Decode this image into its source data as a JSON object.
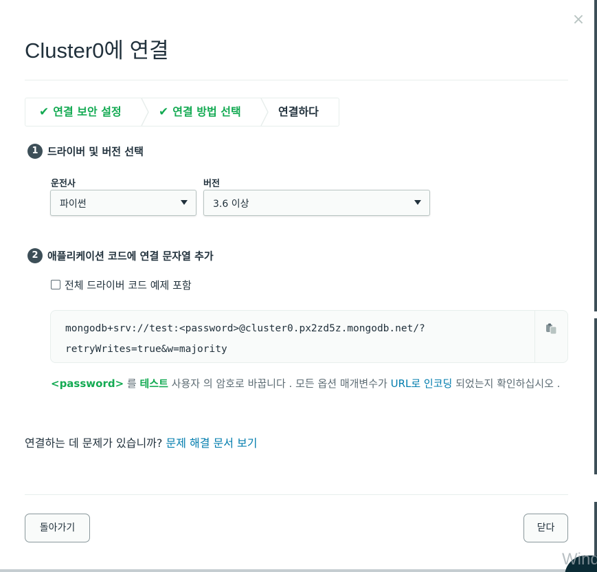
{
  "dialog": {
    "title": "Cluster0에 연결",
    "close_icon": "×"
  },
  "steps": [
    {
      "label": "연결 보안 설정",
      "state": "done"
    },
    {
      "label": "연결 방법 선택",
      "state": "done"
    },
    {
      "label": "연결하다",
      "state": "current"
    }
  ],
  "section1": {
    "number": "1",
    "title": "드라이버 및 버전 선택",
    "driver_label": "운전사",
    "driver_value": "파이썬",
    "version_label": "버전",
    "version_value": "3.6 이상"
  },
  "section2": {
    "number": "2",
    "title": "애플리케이션 코드에 연결 문자열 추가",
    "checkbox_label": "전체 드라이버 코드 예제 포함",
    "code_line1": "mongodb+srv://test:<password>@cluster0.px2zd5z.mongodb.net/?",
    "code_line2": "retryWrites=true&w=majority"
  },
  "note": {
    "pw": "<password>",
    "t1": " 를 ",
    "test": "테스트",
    "t2": " 사용자 의 암호로 바꿉니다 . 모든 옵션 매개변수가 ",
    "url_link": "URL로 인코딩",
    "t3": " 되었는지 확인하십시오 ."
  },
  "trouble": {
    "text": "연결하는 데 문제가 있습니까? ",
    "link": "문제 해결 문서 보기"
  },
  "footer": {
    "back": "돌아가기",
    "close": "닫다"
  },
  "watermark": "Wind",
  "colors": {
    "accent_green": "#13aa52",
    "link_blue": "#007cad",
    "text_dark": "#21313c"
  }
}
